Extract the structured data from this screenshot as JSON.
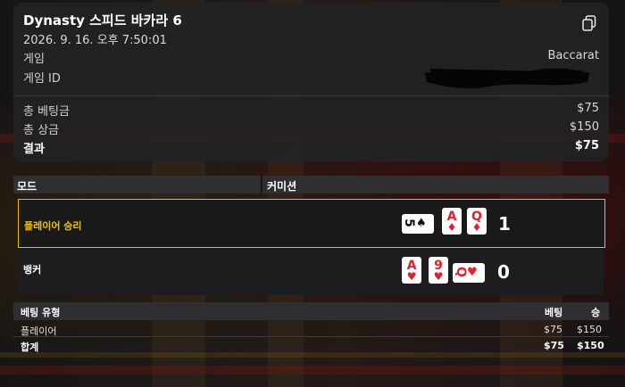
{
  "summary": {
    "title": "Dynasty 스피드 바카라 6",
    "datetime": "2026. 9. 16. 오후 7:50:01",
    "game_label": "게임",
    "game_value": "Baccarat",
    "game_id_label": "게임 ID",
    "total_bet_label": "총 베팅금",
    "total_bet_value": "$75",
    "total_win_label": "총 상금",
    "total_win_value": "$150",
    "result_label": "결과",
    "result_value": "$75"
  },
  "mode_table": {
    "col1": "모드",
    "col2": "커미션"
  },
  "hands": {
    "player": {
      "label": "플레이어 승리",
      "score": "1",
      "cards": [
        {
          "rank": "5",
          "suit": "♠",
          "orientation": "sideways",
          "color": "black"
        },
        {
          "rank": "A",
          "suit": "♦",
          "orientation": "upright",
          "color": "red"
        },
        {
          "rank": "Q",
          "suit": "♦",
          "orientation": "upright",
          "color": "red"
        }
      ]
    },
    "banker": {
      "label": "뱅커",
      "score": "0",
      "cards": [
        {
          "rank": "A",
          "suit": "♥",
          "orientation": "upright",
          "color": "red"
        },
        {
          "rank": "9",
          "suit": "♥",
          "orientation": "upright",
          "color": "red"
        },
        {
          "rank": "Q",
          "suit": "♥",
          "orientation": "sideways",
          "color": "red"
        }
      ]
    }
  },
  "bets": {
    "headers": {
      "type": "베팅 유형",
      "bet": "베팅",
      "win": "승"
    },
    "rows": [
      {
        "type": "플레이어",
        "bet": "$75",
        "win": "$150"
      }
    ],
    "total": {
      "type": "합계",
      "bet": "$75",
      "win": "$150"
    }
  },
  "colors": {
    "highlight_border": "#e6b800",
    "player_win_text": "#f2c200",
    "card_red": "#e3202b"
  }
}
